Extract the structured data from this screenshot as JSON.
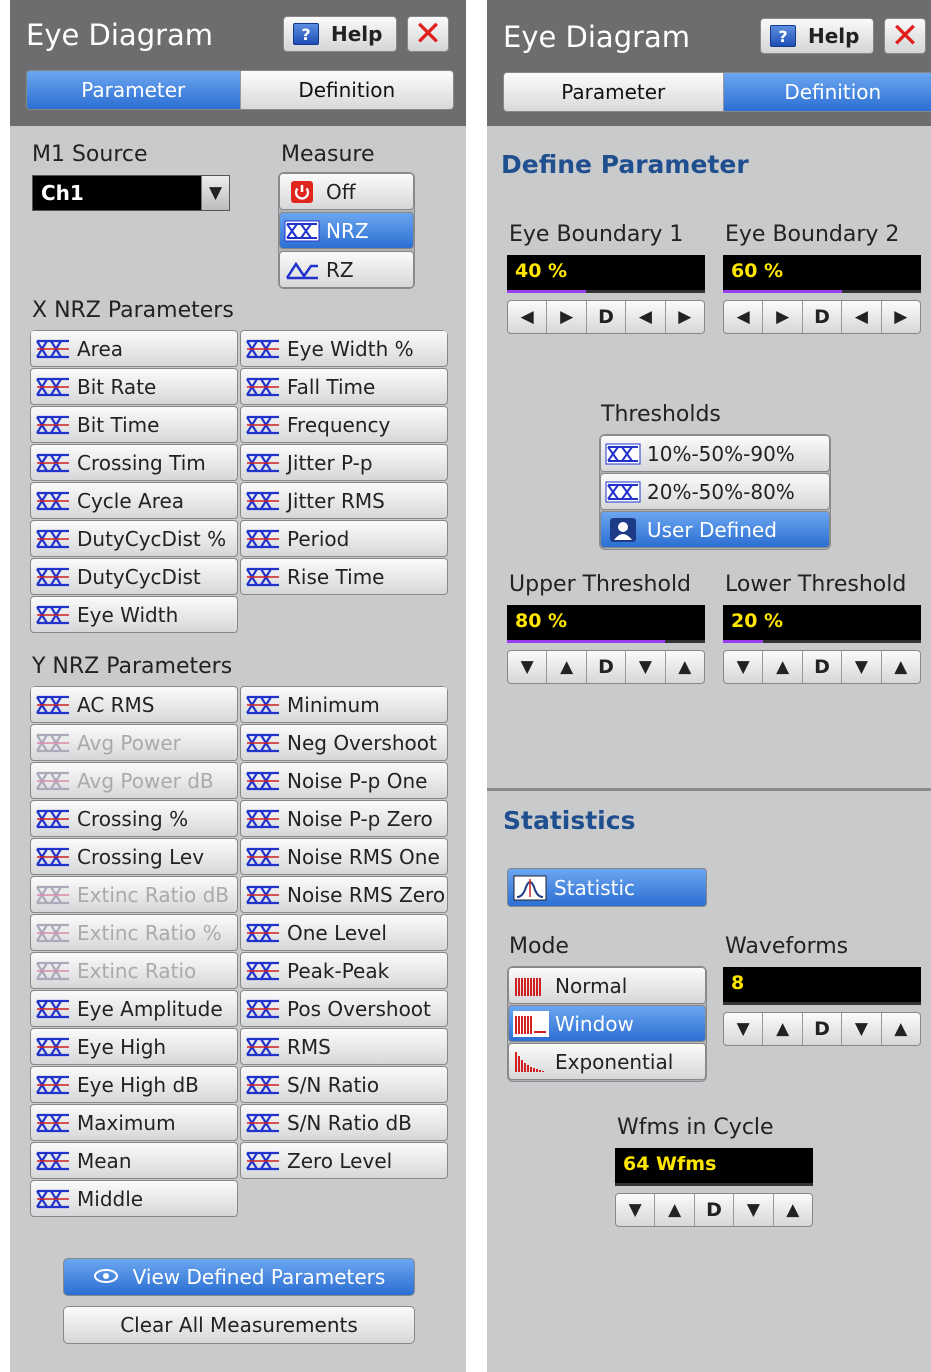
{
  "left": {
    "title": "Eye Diagram",
    "help": "Help",
    "tabs": [
      "Parameter",
      "Definition"
    ],
    "source_label": "M1 Source",
    "source_value": "Ch1",
    "measure_label": "Measure",
    "measure": [
      "Off",
      "NRZ",
      "RZ"
    ],
    "x_title": "X NRZ Parameters",
    "x_col1": [
      "Area",
      "Bit Rate",
      "Bit Time",
      "Crossing Tim",
      "Cycle Area",
      "DutyCycDist %",
      "DutyCycDist",
      "Eye Width"
    ],
    "x_col2": [
      "Eye Width %",
      "Fall Time",
      "Frequency",
      "Jitter P-p",
      "Jitter RMS",
      "Period",
      "Rise Time"
    ],
    "y_title": "Y NRZ Parameters",
    "y_col1": [
      "AC RMS",
      "Avg Power",
      "Avg Power dB",
      "Crossing %",
      "Crossing Lev",
      "Extinc Ratio dB",
      "Extinc Ratio %",
      "Extinc Ratio",
      "Eye Amplitude",
      "Eye High",
      "Eye High dB",
      "Maximum",
      "Mean",
      "Middle"
    ],
    "y_col2": [
      "Minimum",
      "Neg Overshoot",
      "Noise P-p One",
      "Noise P-p Zero",
      "Noise RMS One",
      "Noise RMS Zero",
      "One Level",
      "Peak-Peak",
      "Pos Overshoot",
      "RMS",
      "S/N Ratio",
      "S/N Ratio dB",
      "Zero Level"
    ],
    "view_btn": "View Defined Parameters",
    "clear_btn": "Clear All Measurements"
  },
  "right": {
    "title": "Eye Diagram",
    "help": "Help",
    "tabs": [
      "Parameter",
      "Definition"
    ],
    "define_title": "Define Parameter",
    "boundary1_label": "Eye Boundary 1",
    "boundary1": "40 %",
    "boundary1_level": 0.4,
    "boundary2_label": "Eye Boundary 2",
    "boundary2": "60 %",
    "boundary2_level": 0.6,
    "thresholds_label": "Thresholds",
    "thresholds": [
      "10%-50%-90%",
      "20%-50%-80%",
      "User Defined"
    ],
    "upper_label": "Upper Threshold",
    "upper": "80 %",
    "upper_level": 0.8,
    "lower_label": "Lower Threshold",
    "lower": "20 %",
    "lower_level": 0.2,
    "stats_title": "Statistics",
    "statistic_btn": "Statistic",
    "mode_label": "Mode",
    "modes": [
      "Normal",
      "Window",
      "Exponential"
    ],
    "waveforms_label": "Waveforms",
    "waveforms": "8",
    "wfms_cycle_label": "Wfms in Cycle",
    "wfms_cycle": "64 Wfms",
    "spin_d": "D"
  },
  "colors": {
    "accent": "#2c6fd3",
    "header": "#6c6d6f",
    "panel": "#c9cacc",
    "value_text": "#ffe600",
    "level_bar": "#9a3cf0"
  }
}
